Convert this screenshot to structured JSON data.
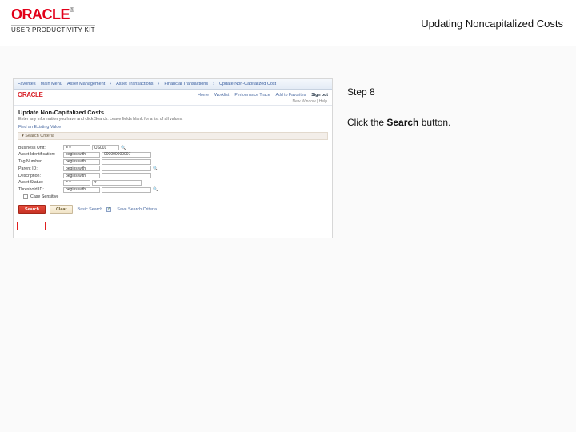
{
  "header": {
    "brand": "ORACLE",
    "tm": "®",
    "product_line": "USER PRODUCTIVITY KIT",
    "doc_title": "Updating Noncapitalized Costs"
  },
  "instructions": {
    "step_label": "Step 8",
    "text_prefix": "Click the ",
    "bold_word": "Search",
    "text_suffix": " button."
  },
  "screenshot": {
    "breadcrumb": [
      "Favorites",
      "Main Menu",
      "Asset Management",
      "Asset Transactions",
      "Financial Transactions",
      "Update Non-Capitalized Cost"
    ],
    "logo": "ORACLE",
    "top_links": [
      "Home",
      "Worklist",
      "Performance Trace",
      "Add to Favorites"
    ],
    "signout": "Sign out",
    "status_line": "New Window | Help",
    "page_title": "Update Non-Capitalized Costs",
    "subtitle": "Enter any information you have and click Search. Leave fields blank for a list of all values.",
    "find_link": "Find an Existing Value",
    "section_header": "▾ Search Criteria",
    "fields": {
      "business_unit": {
        "label": "Business Unit:",
        "value": "US001"
      },
      "asset_id": {
        "label": "Asset Identification:",
        "op": "begins with",
        "value": "000000000007"
      },
      "tag_number": {
        "label": "Tag Number:",
        "op": "begins with",
        "value": ""
      },
      "parent_id": {
        "label": "Parent ID:",
        "op": "begins with",
        "value": ""
      },
      "description": {
        "label": "Description:",
        "op": "begins with",
        "value": ""
      },
      "asset_status": {
        "label": "Asset Status:",
        "value": ""
      },
      "threshold_id": {
        "label": "Threshold ID:",
        "op": "begins with",
        "value": ""
      },
      "case_sensitive": {
        "label": "Case Sensitive"
      }
    },
    "collapse_hint": "",
    "buttons": {
      "search": "Search",
      "clear": "Clear",
      "basic": "Basic Search",
      "save": "Save Search Criteria"
    }
  }
}
